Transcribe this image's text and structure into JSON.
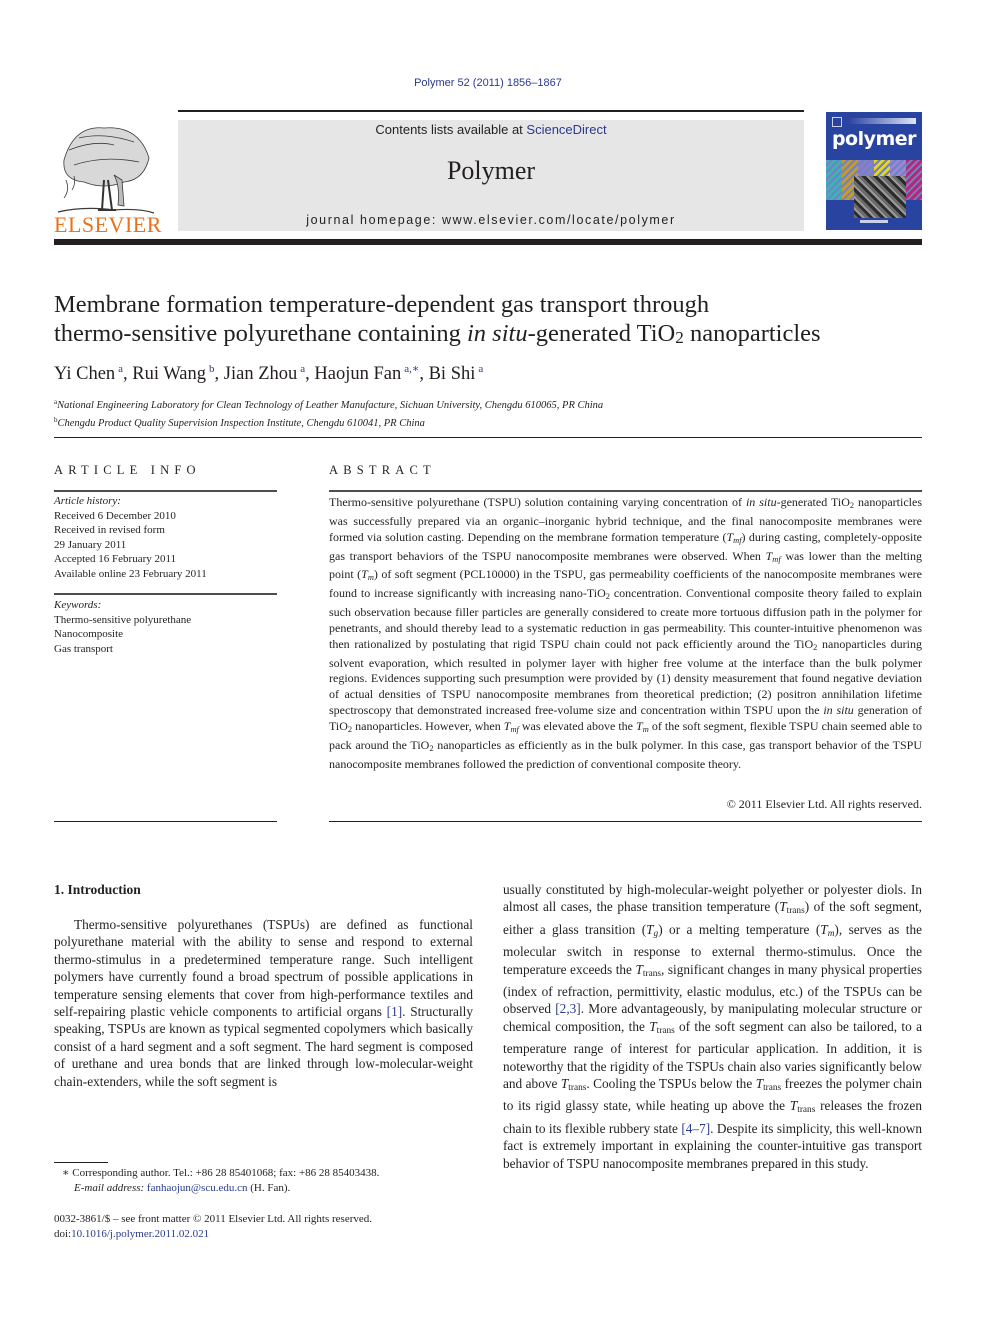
{
  "header": {
    "citation": "Polymer 52 (2011) 1856–1867",
    "contents_prefix": "Contents lists available at ",
    "contents_link": "ScienceDirect",
    "journal_name": "Polymer",
    "homepage": "journal homepage: www.elsevier.com/locate/polymer",
    "publisher_logo_text": "ELSEVIER",
    "cover_title": "polymer",
    "cover_strip_colors": [
      "#3fb0b8",
      "#c69a2c",
      "#8b7fc9",
      "#e8d61a",
      "#9a86d6",
      "#b4277a"
    ]
  },
  "article": {
    "title_line1": "Membrane formation temperature-dependent gas transport through",
    "title_line2_a": "thermo-sensitive polyurethane containing ",
    "title_line2_italic": "in situ",
    "title_line2_b": "-generated TiO",
    "title_line2_sub": "2",
    "title_line2_c": " nanoparticles",
    "authors": [
      {
        "name": "Yi Chen",
        "aff": "a"
      },
      {
        "name": "Rui Wang",
        "aff": "b"
      },
      {
        "name": "Jian Zhou",
        "aff": "a"
      },
      {
        "name": "Haojun Fan",
        "aff": "a,∗"
      },
      {
        "name": "Bi Shi",
        "aff": "a"
      }
    ],
    "affiliations": [
      {
        "mark": "a",
        "text": "National Engineering Laboratory for Clean Technology of Leather Manufacture, Sichuan University, Chengdu 610065, PR China"
      },
      {
        "mark": "b",
        "text": "Chengdu Product Quality Supervision Inspection Institute, Chengdu 610041, PR China"
      }
    ]
  },
  "article_info": {
    "heading": "ARTICLE INFO",
    "history_label": "Article history:",
    "history": [
      "Received 6 December 2010",
      "Received in revised form",
      "29 January 2011",
      "Accepted 16 February 2011",
      "Available online 23 February 2011"
    ],
    "keywords_label": "Keywords:",
    "keywords": [
      "Thermo-sensitive polyurethane",
      "Nanocomposite",
      "Gas transport"
    ]
  },
  "abstract": {
    "heading": "ABSTRACT",
    "copyright": "© 2011 Elsevier Ltd. All rights reserved."
  },
  "intro": {
    "heading": "1.  Introduction",
    "refs": [
      "[1]",
      "[2,3]",
      "[4–7]"
    ]
  },
  "footnotes": {
    "corresponding": "Corresponding author. Tel.: +86 28 85401068; fax: +86 28 85403438.",
    "email_label": "E-mail address:",
    "email": "fanhaojun@scu.edu.cn",
    "email_suffix": " (H. Fan).",
    "front_matter": "0032-3861/$ – see front matter © 2011 Elsevier Ltd. All rights reserved.",
    "doi_prefix": "doi:",
    "doi": "10.1016/j.polymer.2011.02.021"
  }
}
